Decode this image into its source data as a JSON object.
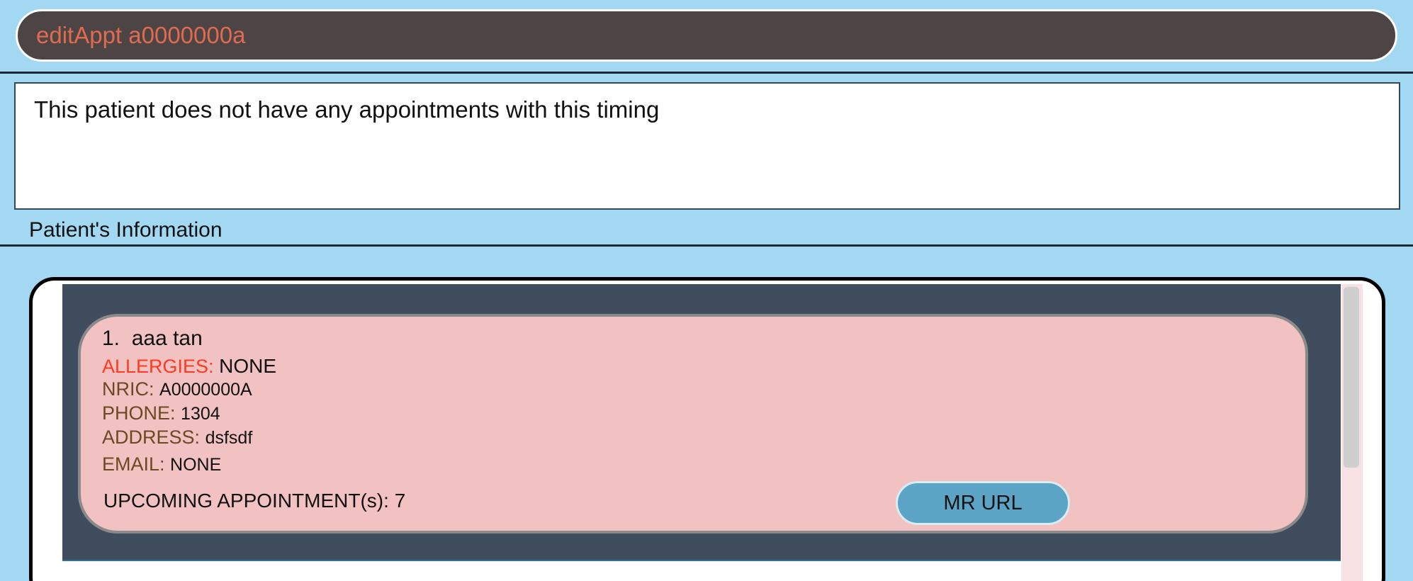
{
  "command_box": {
    "value": "editAppt a0000000a"
  },
  "result_display": {
    "message": "This patient does not have any appointments with this timing"
  },
  "patient_section": {
    "label": "Patient's Information"
  },
  "patients": [
    {
      "index": "1.",
      "name": "aaa tan",
      "allergies_label": "ALLERGIES:",
      "allergies_value": "NONE",
      "nric_label": "NRIC:",
      "nric_value": "A0000000A",
      "phone_label": "PHONE:",
      "phone_value": "1304",
      "address_label": "ADDRESS:",
      "address_value": "dsfsdf",
      "email_label": "EMAIL:",
      "email_value": "NONE",
      "upcoming_appointments_label": "UPCOMING APPOINTMENT(s):",
      "upcoming_appointments_value": "7",
      "mr_button_label": "MR URL"
    }
  ],
  "colors": {
    "background": "#a2d8f2",
    "command_box_bg": "#4d4545",
    "command_text": "#e06b4f",
    "card_bg": "#f2c2c3",
    "list_bg": "#404d5e",
    "allergy_label": "#ff3b1f",
    "field_label": "#6b4a22",
    "mr_button_bg": "#5ca4c6"
  }
}
